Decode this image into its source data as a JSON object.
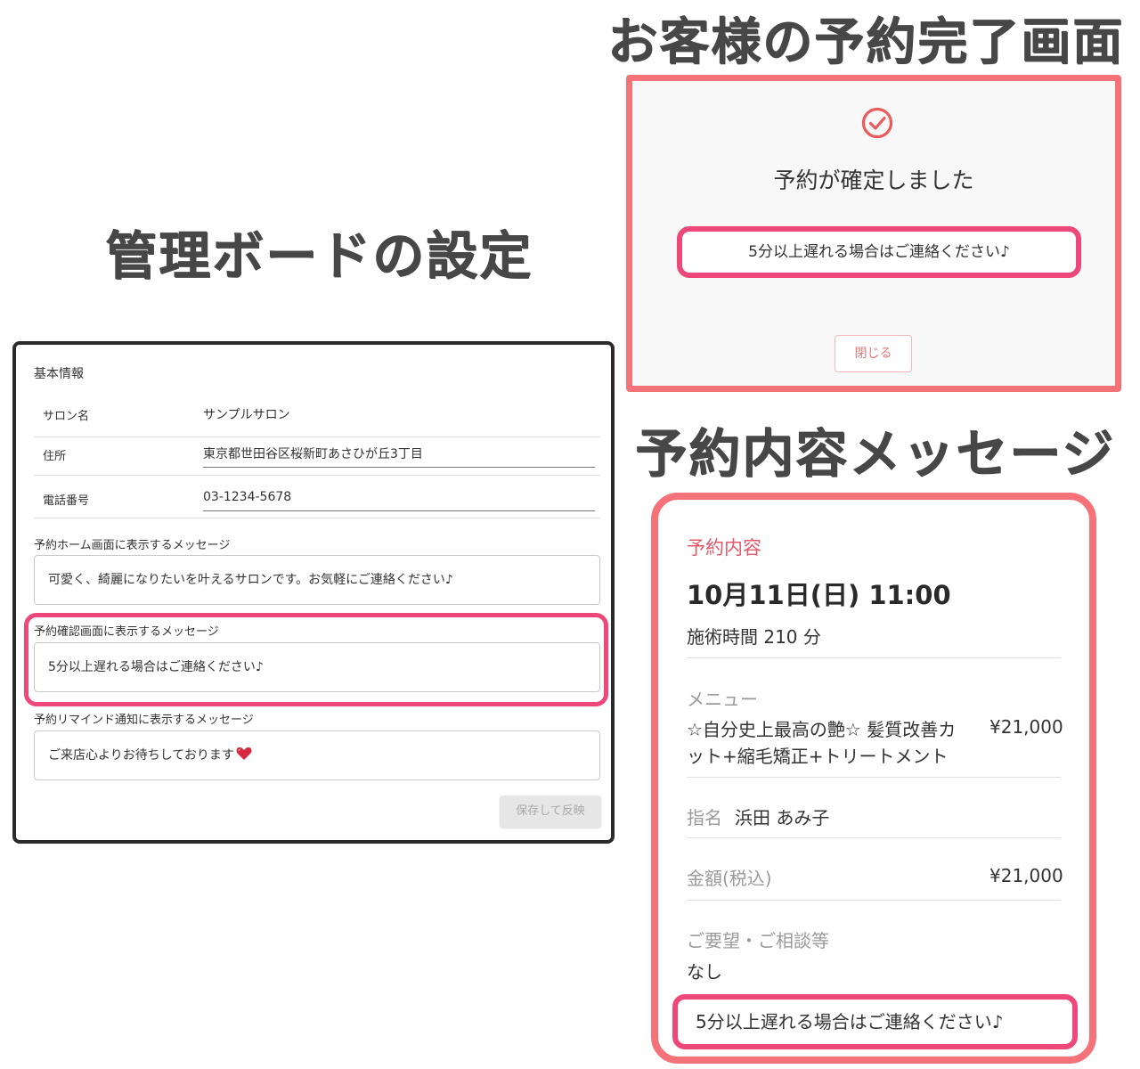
{
  "headings": {
    "completion_screen": "お客様の予約完了画面",
    "admin_settings": "管理ボードの設定",
    "reservation_message": "予約内容メッセージ"
  },
  "admin": {
    "section_title": "基本情報",
    "salon_name_label": "サロン名",
    "salon_name_value": "サンプルサロン",
    "address_label": "住所",
    "address_value": "東京都世田谷区桜新町あさひが丘3丁目",
    "phone_label": "電話番号",
    "phone_value": "03-1234-5678",
    "home_msg_label": "予約ホーム画面に表示するメッセージ",
    "home_msg_value": "可愛く、綺麗になりたいを叶えるサロンです。お気軽にご連絡ください♪",
    "confirm_msg_label": "予約確認画面に表示するメッセージ",
    "confirm_msg_value": "5分以上遅れる場合はご連絡ください♪",
    "remind_msg_label": "予約リマインド通知に表示するメッセージ",
    "remind_msg_value": "ご来店心よりお待ちしております",
    "save_label": "保存して反映"
  },
  "completion": {
    "title": "予約が確定しました",
    "message": "5分以上遅れる場合はご連絡ください♪",
    "close_label": "閉じる"
  },
  "details": {
    "section_title": "予約内容",
    "datetime": "10月11日(日) 11:00",
    "duration": "施術時間 210 分",
    "menu_label": "メニュー",
    "menu_line1": "☆自分史上最高の艶☆ 髪質改善カ",
    "menu_line2": "ット+縮毛矯正+トリートメント",
    "menu_price": "¥21,000",
    "staff_label": "指名",
    "staff_name": "浜田 あみ子",
    "amount_label": "金額(税込)",
    "amount_value": "¥21,000",
    "request_label": "ご要望・ご相談等",
    "request_value": "なし",
    "message": "5分以上遅れる場合はご連絡ください♪"
  },
  "colors": {
    "accent_pink": "#ee4779",
    "frame_coral": "#f57378",
    "heading_gray": "#474747"
  }
}
